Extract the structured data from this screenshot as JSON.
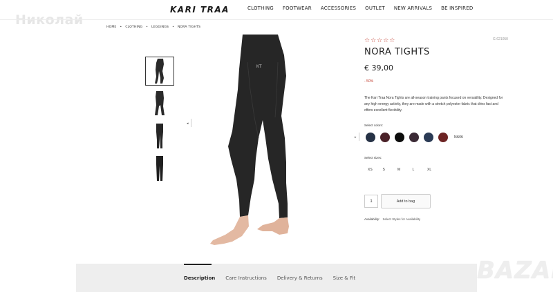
{
  "watermark": {
    "name": "Николай",
    "brand": "BAZAR"
  },
  "header": {
    "logo": "KARI TRAA",
    "nav": [
      "CLOTHING",
      "FOOTWEAR",
      "ACCESSORIES",
      "OUTLET",
      "NEW ARRIVALS",
      "BE INSPIRED"
    ]
  },
  "breadcrumb": [
    "HOME",
    "CLOTHING",
    "LEGGINGS",
    "NORA TIGHTS"
  ],
  "breadcrumb_separator": "•",
  "product": {
    "stars": "☆☆☆☆☆",
    "sku": "G 621050",
    "title": "NORA TIGHTS",
    "price": "€ 39,00",
    "discount": "- 50%",
    "description": "The Kari Traa Nora Tights are all-season training pants focused on versatility. Designed for any high energy activity, they are made with a stretch polyester fabric that dries fast and offers excellent flexibility.",
    "color_label": "Select colors:",
    "colors": [
      {
        "name": "navy-blue",
        "hex": "#263246"
      },
      {
        "name": "burgundy",
        "hex": "#4a2128"
      },
      {
        "name": "black",
        "hex": "#0d0d0d"
      },
      {
        "name": "plum",
        "hex": "#3b2a35"
      },
      {
        "name": "slate-blue",
        "hex": "#2b3b55"
      },
      {
        "name": "red-wine",
        "hex": "#6d2424"
      }
    ],
    "selected_color": "NAVA",
    "size_label": "Select sizes:",
    "sizes": [
      "XS",
      "S",
      "M",
      "L",
      "XL"
    ],
    "quantity": "1",
    "add_to_bag": "Add to bag",
    "availability_label": "Availability:",
    "availability_value": "Select Styles for Availability"
  },
  "tabs": [
    "Description",
    "Care Instructions",
    "Delivery & Returns",
    "Size & Fit"
  ],
  "active_tab": "Description",
  "accent_color": "#c0392b"
}
